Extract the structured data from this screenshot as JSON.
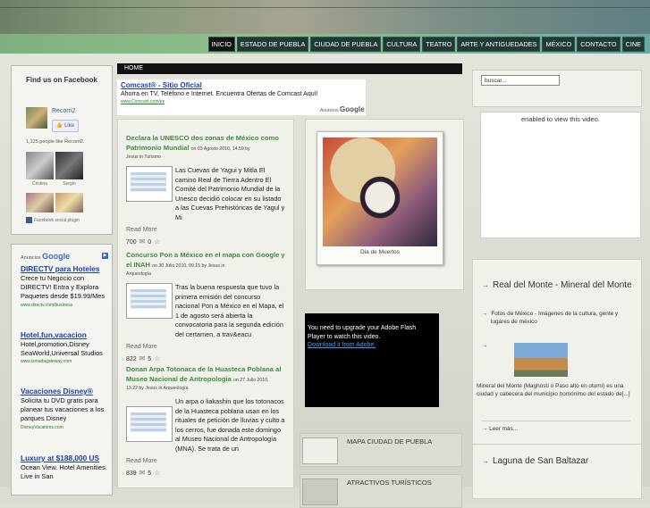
{
  "nav": {
    "items": [
      "INICIO",
      "ESTADO DE PUEBLA",
      "CIUDAD DE PUEBLA",
      "CULTURA",
      "TEATRO",
      "ARTE Y ANTIGUEDADES",
      "MÉXICO",
      "CONTACTO",
      "CINE"
    ]
  },
  "facebook": {
    "title": "Find us on Facebook",
    "page_name": "Recorri2",
    "like_label": "Like",
    "count_text": "1,125 people like Recorri2.",
    "fans": [
      "Cristina",
      "Sergio",
      "",
      ""
    ],
    "plugin_label": "Facebook social plugin"
  },
  "left_ads": {
    "google_label": "Anuncios",
    "google_word": "Google",
    "items": [
      {
        "title": "DIRECTV para Hoteles",
        "text": "Crece tu Negocio con DIRECTV! Entra y Explora Paquetes desde $19.99/Mes",
        "url": "www.directv.com/business"
      },
      {
        "title": "Hotel,fun,vacacion",
        "text": "Hotel,promotion,Disney SeaWorld,Universal Studios",
        "url": "www.ismadagateway.com"
      },
      {
        "title": "Vacaciones Disney®",
        "text": "Solicita tu DVD gratis para planear tus vacaciones a los parques Disney",
        "url": "DisneyVacations.com"
      },
      {
        "title": "Luxury at $188,000 US",
        "text": "Ocean View. Hotel Amenities. Live in San",
        "url": ""
      }
    ]
  },
  "main": {
    "breadcrumb": "HOME",
    "top_ad": {
      "title": "Comcast® - Sitio Oficial",
      "text": "Ahorra en TV, Teléfono e Internet. Encuentra Ofertas de Comcast Aquí!",
      "url": "www.Comcast.com/es",
      "google_label": "Anuncios",
      "google_word": "Google"
    },
    "posts": [
      {
        "title": "Declara la UNESCO dos zonas de México como Patrimonio Mundial",
        "date": "on 03 Agosto 2010, 14.59 by",
        "meta": "Jesus in Turismo",
        "body": "Las Cuevas de Yagui y Mitla El camino Real de Tierra Adentro El Comité del Patrimonio Mundial de la Unesco decidió colocar en su listado a las Cuevas Prehistóricas de Yagul y Mi",
        "readmore": "Read More",
        "views": "700",
        "comments": "0"
      },
      {
        "title": "Concurso Pon a México en el mapa con Google y el INAH",
        "date": "on 30 Julio 2010, 09.15 by Jesus in",
        "meta": "Arqueología",
        "body": "Tras la buena respuesta que tuvo la primera emisión del concurso nacional Pon a México en el Mapa, el 1 de agosto será abierta la convocatoria para la segunda edición del certamen, a trav&eacu",
        "readmore": "Read More",
        "views": "822",
        "comments": "5"
      },
      {
        "title": "Donan Arpa Totonaca de la Huasteca Poblana al Museo Nacional de Antropologia",
        "date": "on 27 Julio 2010,",
        "meta": "13.22 by Jesus in Arqueología",
        "body": "Un arpa o liakashin que los totonacos de la Huasteca poblana usan en los rituales de petición de lluvias y culto a los cerros, fue donada este domingo al Museo Nacional de Antropología (MNA). Se trata de un",
        "readmore": "Read More",
        "views": "839",
        "comments": "5"
      }
    ],
    "photo_caption": "Dia de Muertos",
    "flash_text": "You need to upgrade your Adobe Flash Player to watch this video.",
    "flash_link": "Download it from Adobe.",
    "links": [
      "MAPA CIUDAD DE PUEBLA",
      "ATRACTIVOS TURÍSTICOS"
    ]
  },
  "right": {
    "search_value": "buscar...",
    "video_text": "enabled to view this video.",
    "box1": {
      "title": "Real del Monte - Mineral del Monte",
      "subtitle": "Fotos de México - Imágenes de la cultura, gente y lugares de méxico",
      "desc": "Mineral del Monte (Maghostí o Paso alto en otomí) es una ciudad y cabecera del municipio homónimo del estado de[...]",
      "more": "Leer más..."
    },
    "box2": {
      "title": "Laguna de San Baltazar"
    }
  }
}
